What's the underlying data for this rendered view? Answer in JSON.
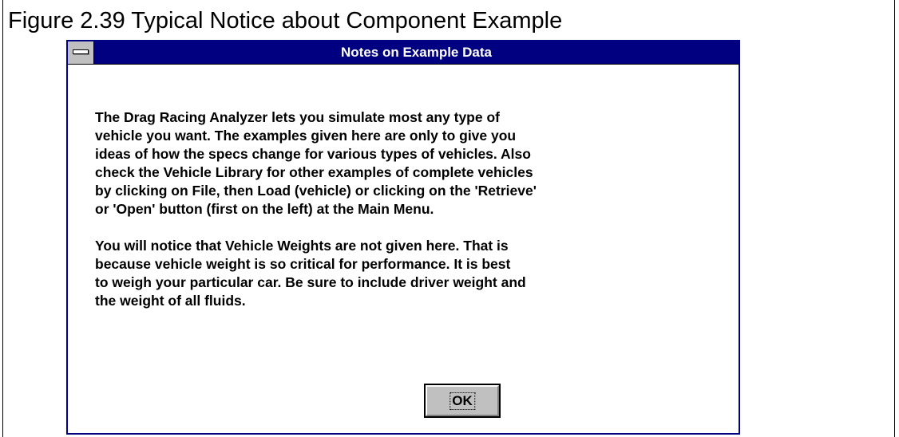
{
  "figure": {
    "caption": "Figure 2.39  Typical Notice about Component Example"
  },
  "dialog": {
    "title": "Notes on Example Data",
    "system_menu_icon": "system-menu-icon",
    "paragraphs": [
      "The Drag Racing Analyzer lets you simulate most any type of\nvehicle you want.  The examples given here are only to give you\nideas of how the specs change for various types of vehicles.  Also\ncheck the Vehicle Library for other examples of complete vehicles\nby clicking on File, then Load (vehicle) or clicking on the 'Retrieve'\nor 'Open' button (first on the left) at the Main Menu.",
      "You will notice that Vehicle Weights are not given here.  That is\nbecause vehicle weight is so critical for performance.  It is best\nto weigh your particular car.  Be sure to include driver weight and\nthe weight of all fluids."
    ],
    "ok_label": "OK"
  },
  "colors": {
    "titlebar": "#000080",
    "button_face": "#c0c0c0",
    "dialog_border": "#000080"
  }
}
